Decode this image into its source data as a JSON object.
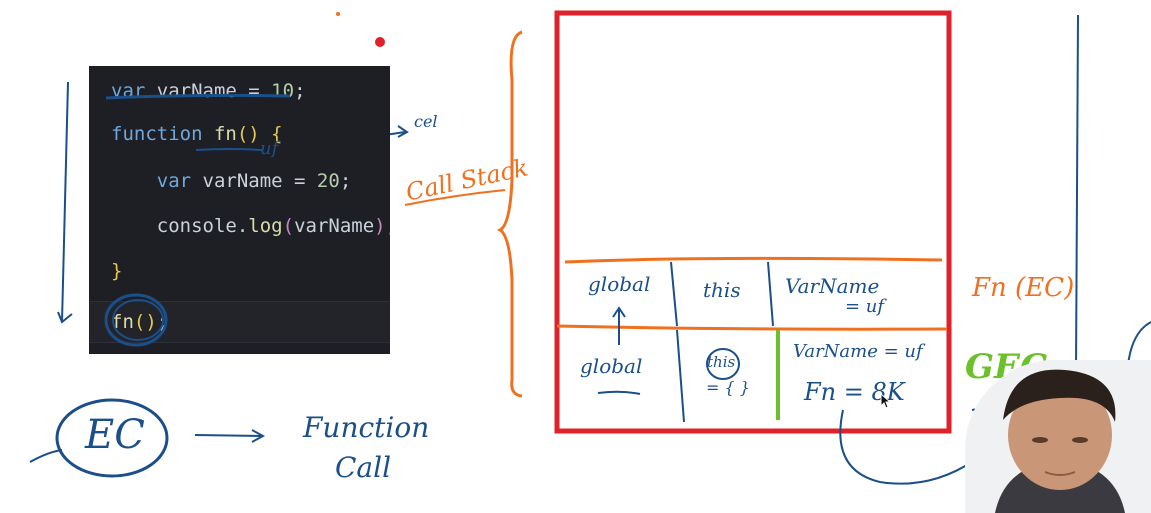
{
  "code": {
    "lines": [
      [
        {
          "t": "var ",
          "c": "kw"
        },
        {
          "t": "varName",
          "c": "ident"
        },
        {
          "t": " = ",
          "c": "ident"
        },
        {
          "t": "10",
          "c": "num"
        },
        {
          "t": ";",
          "c": "ident"
        }
      ],
      [
        {
          "t": "function ",
          "c": "kw"
        },
        {
          "t": "fn",
          "c": "fnname"
        },
        {
          "t": "() ",
          "c": "paren"
        },
        {
          "t": "{",
          "c": "paren"
        }
      ],
      [
        {
          "t": "    var ",
          "c": "kw"
        },
        {
          "t": "varName",
          "c": "ident"
        },
        {
          "t": " = ",
          "c": "ident"
        },
        {
          "t": "20",
          "c": "num"
        },
        {
          "t": ";",
          "c": "ident"
        }
      ],
      [
        {
          "t": "    console",
          "c": "ident"
        },
        {
          "t": ".",
          "c": "ident"
        },
        {
          "t": "log",
          "c": "fnname"
        },
        {
          "t": "(",
          "c": "paren2"
        },
        {
          "t": "varName",
          "c": "ident"
        },
        {
          "t": ")",
          "c": "paren2"
        },
        {
          "t": ";",
          "c": "ident"
        }
      ],
      [
        {
          "t": "}",
          "c": "paren"
        }
      ],
      [
        {
          "t": "fn",
          "c": "fnname"
        },
        {
          "t": "()",
          "c": "paren"
        },
        {
          "t": ";",
          "c": "ident"
        }
      ]
    ]
  },
  "annotations": {
    "call_stack": "Call Stack",
    "cel": "cel",
    "uf": "uf",
    "fn_ec": "Fn (EC)",
    "gec": "GEC",
    "ec": "EC",
    "function_call_1": "Function",
    "function_call_2": "Call"
  },
  "stack": {
    "fn_frame": {
      "scope": "global",
      "this": "this",
      "vars_1": "VarName",
      "vars_2": "= uf"
    },
    "global_frame": {
      "scope": "global",
      "this_1": "this",
      "this_2": "= { }",
      "vars_1": "VarName = uf",
      "vars_2": "Fn = 8K"
    }
  },
  "colors": {
    "stack_border": "#e0202a",
    "orange_ink": "#f07020",
    "blue_ink": "#1a4f8a",
    "green_ink": "#6cc02a",
    "editor_bg": "#1e1f24"
  }
}
